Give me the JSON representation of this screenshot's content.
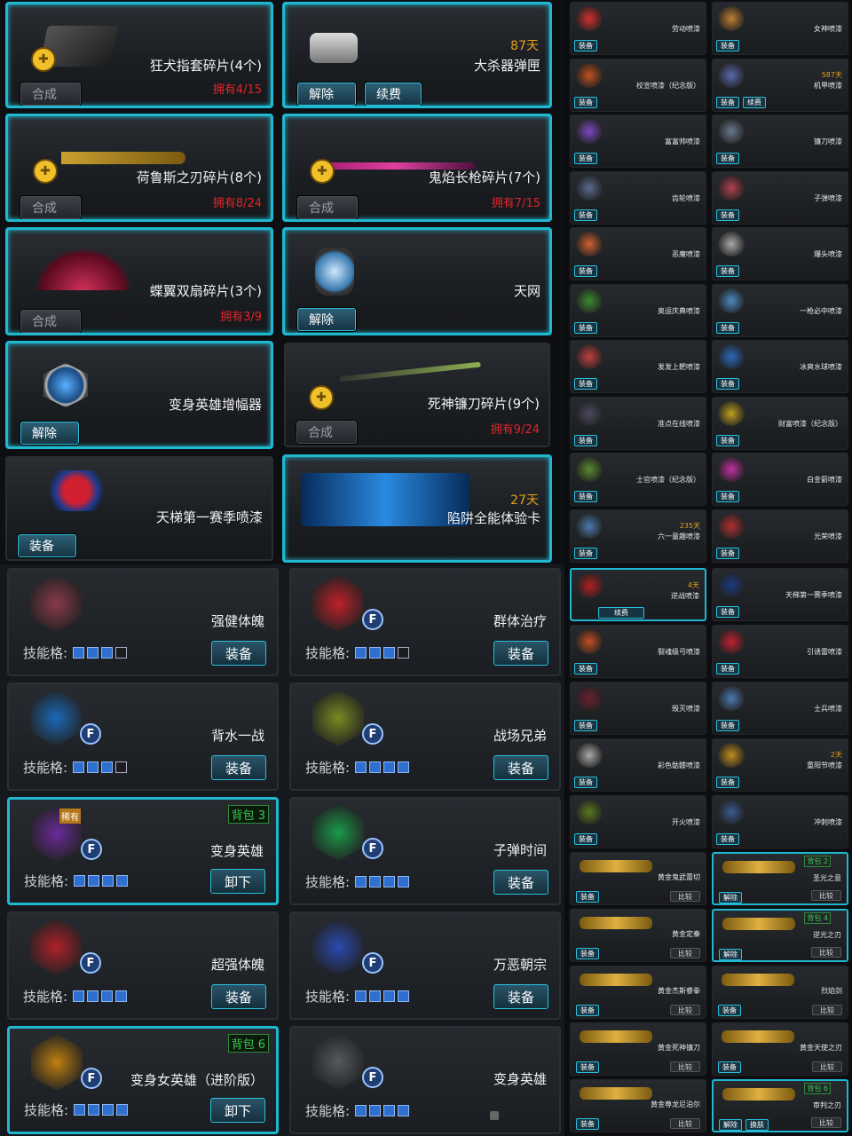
{
  "inventory": [
    {
      "name": "狂犬指套碎片(4个)",
      "owned": "拥有4/15",
      "btn": "合成",
      "days": ""
    },
    {
      "name": "大杀器弹匣",
      "days": "87天",
      "btns": [
        "解除",
        "续费"
      ]
    },
    {
      "name": "荷鲁斯之刃碎片(8个)",
      "owned": "拥有8/24",
      "btn": "合成"
    },
    {
      "name": "鬼焰长枪碎片(7个)",
      "owned": "拥有7/15",
      "btn": "合成"
    },
    {
      "name": "蝶翼双扇碎片(3个)",
      "owned": "拥有3/9",
      "btn": "合成"
    },
    {
      "name": "天网",
      "btn": "解除"
    },
    {
      "name": "变身英雄增幅器",
      "btn": "解除"
    },
    {
      "name": "死神镰刀碎片(9个)",
      "owned": "拥有9/24",
      "btn": "合成"
    },
    {
      "name": "天梯第一赛季喷漆",
      "btn": "装备"
    },
    {
      "name": "陷阱全能体验卡",
      "days": "27天"
    }
  ],
  "skills": {
    "slot_label": "技能格:",
    "items": [
      {
        "name": "强健体魄",
        "btn": "装备",
        "slots": 3
      },
      {
        "name": "群体治疗",
        "btn": "装备",
        "slots": 3
      },
      {
        "name": "背水一战",
        "btn": "装备",
        "slots": 3
      },
      {
        "name": "战场兄弟",
        "btn": "装备",
        "slots": 4
      },
      {
        "name": "变身英雄",
        "btn": "卸下",
        "slots": 4,
        "bag": "背包 3",
        "rare": "稀有"
      },
      {
        "name": "子弹时间",
        "btn": "装备",
        "slots": 4
      },
      {
        "name": "超强体魄",
        "btn": "装备",
        "slots": 4
      },
      {
        "name": "万恶朝宗",
        "btn": "装备",
        "slots": 4
      },
      {
        "name": "变身女英雄（进阶版）",
        "btn": "卸下",
        "slots": 4,
        "bag": "背包 6"
      },
      {
        "name": "变身英雄",
        "btn": "",
        "slots": 4,
        "locked": true
      }
    ]
  },
  "sprays": [
    {
      "name": "劳动喷漆",
      "btn": "装备"
    },
    {
      "name": "女神喷漆",
      "btn": "装备"
    },
    {
      "name": "校宣喷漆（纪念版）",
      "btn": "装备"
    },
    {
      "name": "机甲喷漆",
      "days": "587天",
      "btns": [
        "装备",
        "续费"
      ]
    },
    {
      "name": "富富帅喷漆",
      "btn": "装备"
    },
    {
      "name": "镰刀喷漆",
      "btn": "装备"
    },
    {
      "name": "齿轮喷漆",
      "btn": "装备"
    },
    {
      "name": "子弹喷漆",
      "btn": "装备"
    },
    {
      "name": "恶魔喷漆",
      "btn": "装备"
    },
    {
      "name": "爆头喷漆",
      "btn": "装备"
    },
    {
      "name": "奥运庆典喷漆",
      "btn": "装备"
    },
    {
      "name": "一枪必中喷漆",
      "btn": "装备"
    },
    {
      "name": "发发上靶喷漆",
      "btn": "装备"
    },
    {
      "name": "冰爽水球喷漆",
      "btn": "装备"
    },
    {
      "name": "准点在线喷漆",
      "btn": "装备"
    },
    {
      "name": "财富喷漆（纪念版）",
      "btn": "装备"
    },
    {
      "name": "士官喷漆（纪念版）",
      "btn": "装备"
    },
    {
      "name": "白金箭喷漆",
      "btn": "装备"
    },
    {
      "name": "六一童趣喷漆",
      "days": "235天",
      "btn": "装备"
    },
    {
      "name": "光荣喷漆",
      "btn": "装备"
    }
  ],
  "sprays2": [
    {
      "name": "逆战喷漆",
      "days": "4天",
      "btn": "续费"
    },
    {
      "name": "天梯第一赛季喷漆",
      "btn": "装备"
    },
    {
      "name": "裂魂级弓喷漆",
      "btn": "装备"
    },
    {
      "name": "引诱雷喷漆",
      "btn": "装备"
    },
    {
      "name": "毁灭喷漆",
      "btn": "装备"
    },
    {
      "name": "士兵喷漆",
      "btn": "装备"
    },
    {
      "name": "彩色骷髅喷漆",
      "btn": "装备"
    },
    {
      "name": "重阳节喷漆",
      "days": "2天",
      "btn": "装备"
    },
    {
      "name": "开火喷漆",
      "btn": "装备"
    },
    {
      "name": "冲刺喷漆",
      "btn": "装备"
    }
  ],
  "weapons": [
    {
      "name": "黄金鬼武蕾切",
      "btn": "装备",
      "cmp": "比较"
    },
    {
      "name": "圣光之意",
      "btn": "解除",
      "cmp": "比较",
      "bag": "背包 2"
    },
    {
      "name": "黄金定秦",
      "btn": "装备",
      "cmp": "比较"
    },
    {
      "name": "逆光之刃",
      "btn": "解除",
      "cmp": "比较",
      "bag": "背包 4"
    },
    {
      "name": "黄金杰斯睿拳",
      "btn": "装备",
      "cmp": "比较"
    },
    {
      "name": "烈焰剑",
      "btn": "装备",
      "cmp": "比较"
    },
    {
      "name": "黄金死神镰刀",
      "btn": "装备",
      "cmp": "比较"
    },
    {
      "name": "黄金天使之刃",
      "btn": "装备",
      "cmp": "比较"
    },
    {
      "name": "黄金尊龙尼泊尔",
      "btn": "装备",
      "cmp": "比较"
    },
    {
      "name": "审判之刃",
      "btns": [
        "解除",
        "换肤"
      ],
      "cmp": "比较",
      "bag": "背包 6"
    }
  ],
  "colors": {
    "accent": "#1fb8d0",
    "owned": "#e0242a",
    "days": "#e6a21a",
    "bag": "#39c84a"
  }
}
